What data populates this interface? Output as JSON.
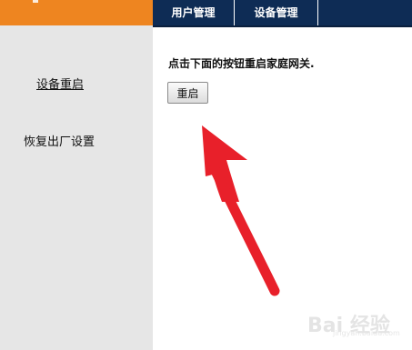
{
  "header": {
    "tabs": [
      {
        "label": "用户管理"
      },
      {
        "label": "设备管理"
      }
    ]
  },
  "sidebar": {
    "items": [
      {
        "label": "设备重启"
      },
      {
        "label": "恢复出厂设置"
      }
    ]
  },
  "main": {
    "instruction": "点击下面的按钮重启家庭网关.",
    "restart_button_label": "重启"
  },
  "annotation": {
    "arrow_color": "#e8202a"
  },
  "watermark": {
    "text": "Bai 经验",
    "subtext": "jingyan.baidu.com"
  },
  "colors": {
    "header_orange": "#ee8520",
    "nav_navy": "#0e2c55",
    "sidebar_gray": "#e6e6e6"
  }
}
